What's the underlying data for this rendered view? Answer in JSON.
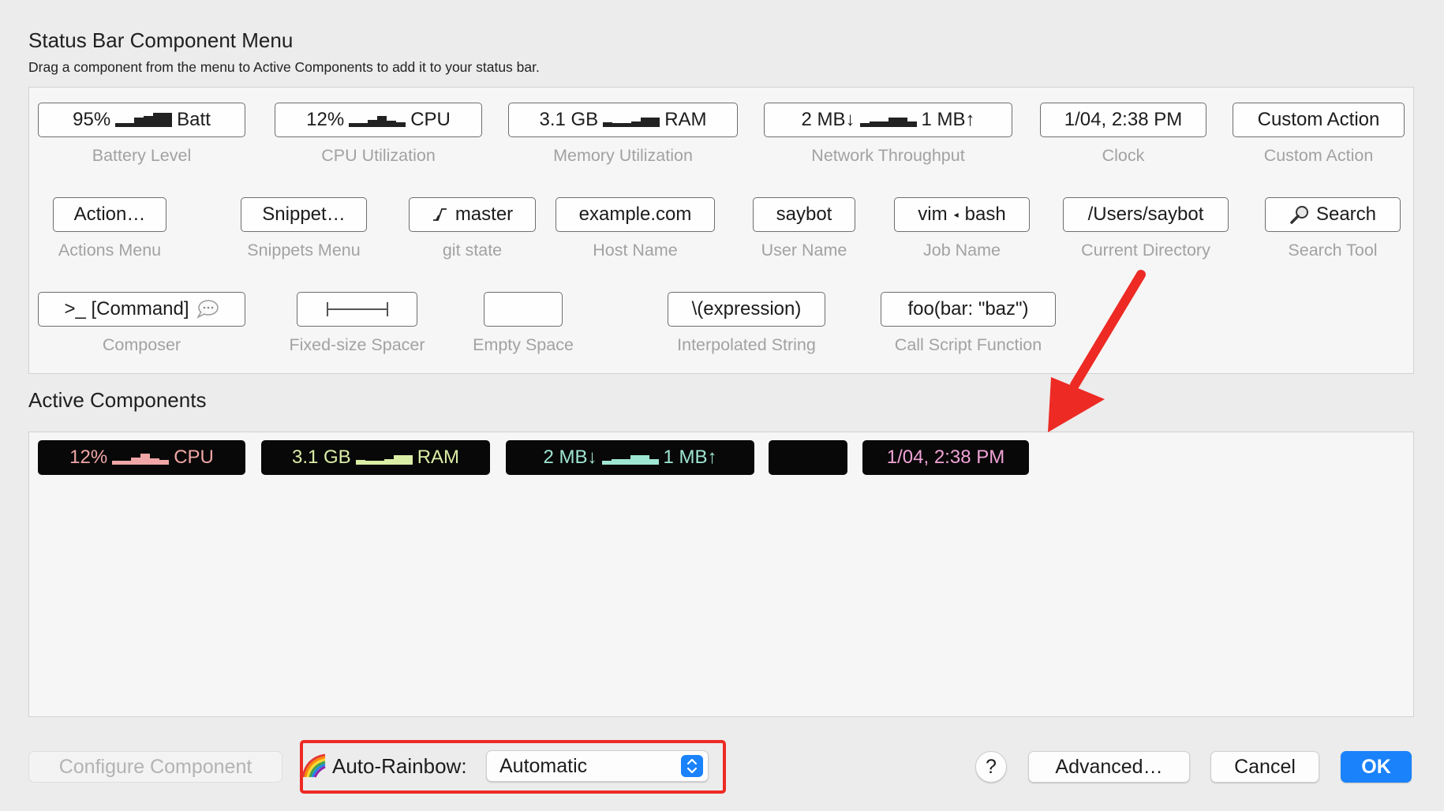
{
  "header": {
    "title": "Status Bar Component Menu",
    "subtitle": "Drag a component from the menu to Active Components to add it to your status bar."
  },
  "menu": {
    "battery": {
      "value": "95%",
      "suffix": "Batt",
      "label": "Battery Level"
    },
    "cpu": {
      "value": "12%",
      "suffix": "CPU",
      "label": "CPU Utilization"
    },
    "memory": {
      "value": "3.1 GB",
      "suffix": "RAM",
      "label": "Memory Utilization"
    },
    "network": {
      "value": "2 MB↓",
      "suffix": "1 MB↑",
      "label": "Network Throughput"
    },
    "clock": {
      "value": "1/04, 2:38 PM",
      "label": "Clock"
    },
    "custom_action": {
      "value": "Custom Action",
      "label": "Custom Action"
    },
    "actions_menu": {
      "value": "Action…",
      "label": "Actions Menu"
    },
    "snippets_menu": {
      "value": "Snippet…",
      "label": "Snippets Menu"
    },
    "git_state": {
      "value": "master",
      "label": "git state"
    },
    "host_name": {
      "value": "example.com",
      "label": "Host Name"
    },
    "user_name": {
      "value": "saybot",
      "label": "User Name"
    },
    "job_name": {
      "value": "vim",
      "value2": "bash",
      "label": "Job Name"
    },
    "current_directory": {
      "value": "/Users/saybot",
      "label": "Current Directory"
    },
    "search_tool": {
      "value": "Search",
      "label": "Search Tool"
    },
    "composer": {
      "value": ">_ [Command]",
      "label": "Composer"
    },
    "fixed_spacer": {
      "label": "Fixed-size Spacer"
    },
    "empty_space": {
      "label": "Empty Space"
    },
    "interpolated_string": {
      "value": "\\(expression)",
      "label": "Interpolated String"
    },
    "call_script": {
      "value": "foo(bar: \"baz\")",
      "label": "Call Script Function"
    }
  },
  "active": {
    "title": "Active Components",
    "cpu": {
      "value": "12%",
      "suffix": "CPU",
      "color": "#f0a6a6"
    },
    "ram": {
      "value": "3.1 GB",
      "suffix": "RAM",
      "color": "#dbeea6"
    },
    "network": {
      "value": "2 MB↓",
      "suffix": "1 MB↑",
      "color": "#9fe6d2"
    },
    "clock": {
      "value": "1/04, 2:38 PM",
      "color": "#f0a3d6"
    }
  },
  "footer": {
    "configure": "Configure Component",
    "rainbow_label": "Auto-Rainbow:",
    "rainbow_value": "Automatic",
    "help": "?",
    "advanced": "Advanced…",
    "cancel": "Cancel",
    "ok": "OK"
  },
  "colors": {
    "accent": "#1a82fb",
    "annotation": "#ee2a24"
  },
  "icons": [
    "git-branch-icon",
    "magnifier-icon",
    "speech-bubble-icon",
    "rainbow-icon",
    "popup-stepper-icon",
    "arrow-annotation"
  ]
}
